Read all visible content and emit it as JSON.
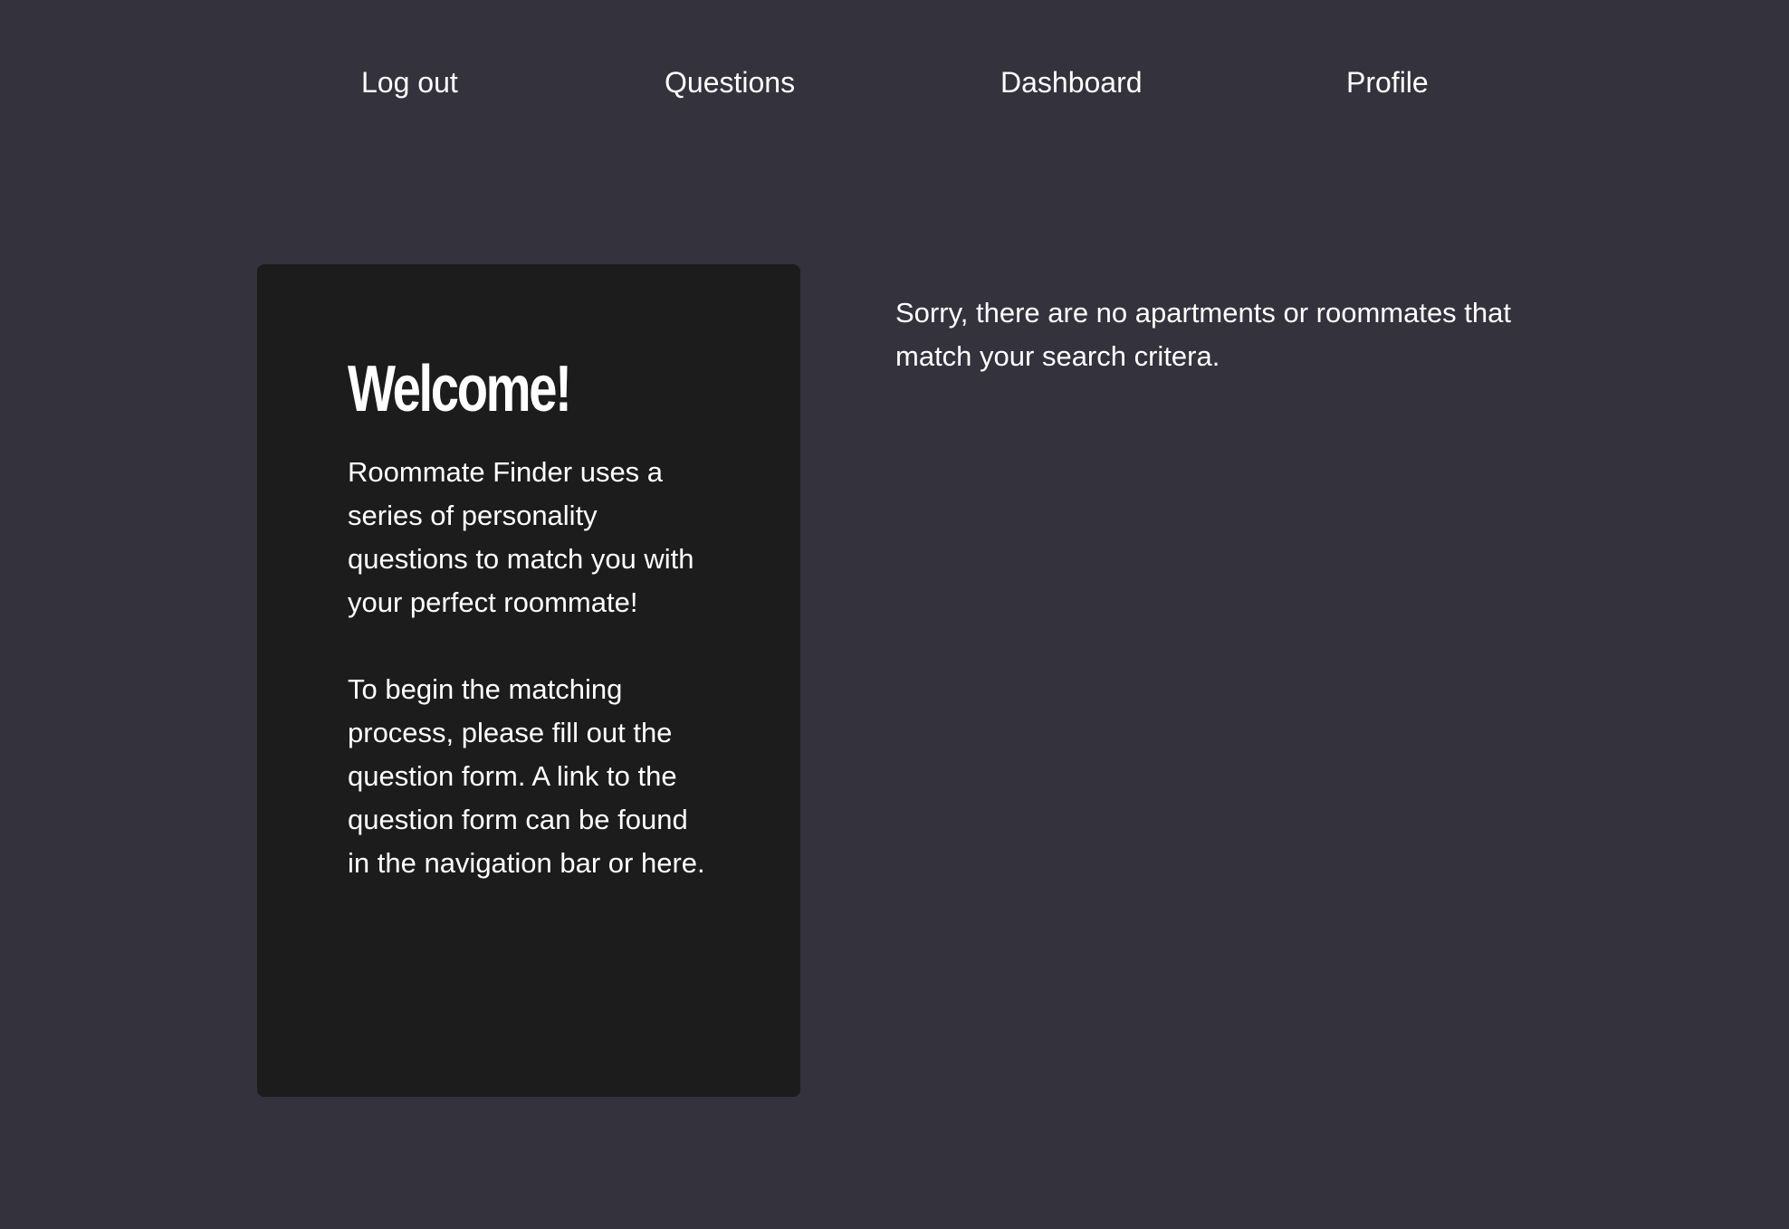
{
  "nav": {
    "logout": "Log out",
    "questions": "Questions",
    "dashboard": "Dashboard",
    "profile": "Profile"
  },
  "welcome": {
    "title": "Welcome!",
    "paragraph1": "Roommate Finder uses a series of personality questions to match you with your perfect roommate!",
    "paragraph2": "To begin the matching process, please fill out the question form. A link to the question form can be found in the navigation bar or here."
  },
  "results": {
    "message": "Sorry, there are no apartments or roommates that match your search critera."
  },
  "colors": {
    "background": "#33323d",
    "card_background": "#1c1c1c",
    "text": "#ffffff"
  }
}
